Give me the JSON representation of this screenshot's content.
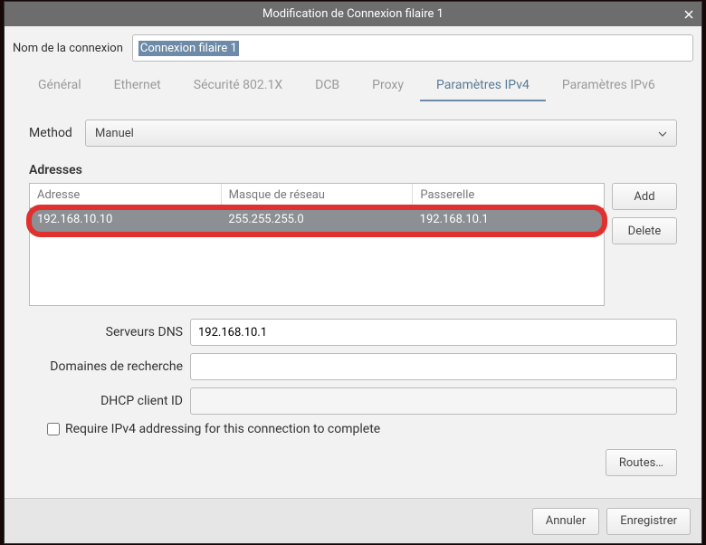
{
  "titlebar": {
    "title": "Modification de Connexion filaire 1"
  },
  "nameRow": {
    "label": "Nom de la connexion",
    "value": "Connexion filaire 1"
  },
  "tabs": [
    "Général",
    "Ethernet",
    "Sécurité 802.1X",
    "DCB",
    "Proxy",
    "Paramètres IPv4",
    "Paramètres IPv6"
  ],
  "activeTab": 5,
  "method": {
    "label": "Method",
    "value": "Manuel"
  },
  "addresses": {
    "label": "Adresses",
    "headers": [
      "Adresse",
      "Masque de réseau",
      "Passerelle"
    ],
    "rows": [
      {
        "addr": "192.168.10.10",
        "mask": "255.255.255.0",
        "gw": "192.168.10.1"
      }
    ],
    "addBtn": "Add",
    "deleteBtn": "Delete"
  },
  "dns": {
    "label": "Serveurs DNS",
    "value": "192.168.10.1"
  },
  "search": {
    "label": "Domaines de recherche",
    "value": ""
  },
  "dhcp": {
    "label": "DHCP client ID",
    "value": ""
  },
  "require": {
    "label": "Require IPv4 addressing for this connection to complete"
  },
  "routesBtn": "Routes…",
  "footer": {
    "cancel": "Annuler",
    "save": "Enregistrer"
  }
}
